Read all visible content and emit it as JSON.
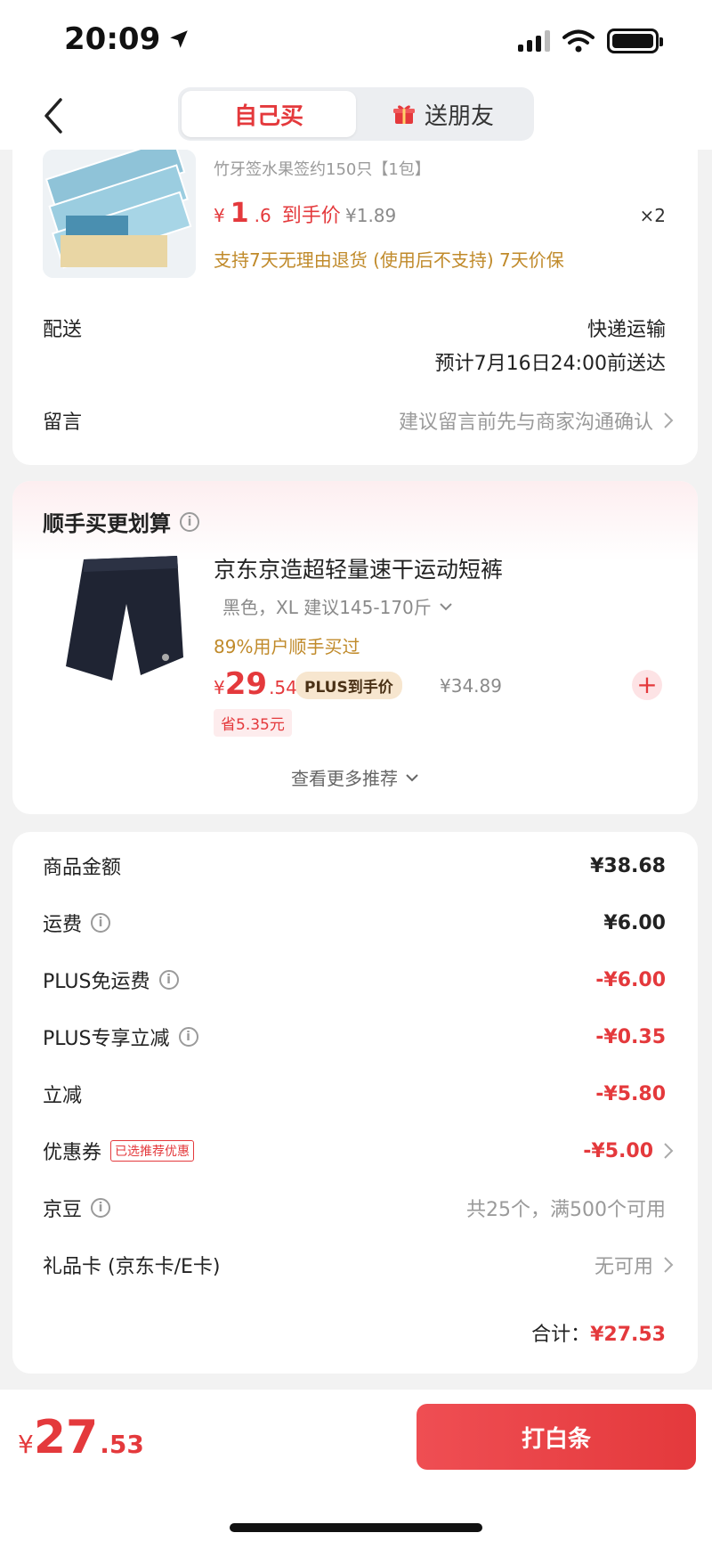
{
  "status_bar": {
    "time": "20:09"
  },
  "nav": {
    "tab_self": "自己买",
    "tab_gift": "送朋友"
  },
  "product1": {
    "subtitle": "竹牙签水果签约150只【1包】",
    "price_yen": "¥",
    "price_int": "1",
    "price_dec": ".6",
    "price_suffix": "到手价",
    "original_price": "¥1.89",
    "qty": "×2",
    "return_policy": "支持7天无理由退货 (使用后不支持)  7天价保"
  },
  "shipping": {
    "label": "配送",
    "method": "快递运输",
    "eta": "预计7月16日24:00前送达"
  },
  "message": {
    "label": "留言",
    "placeholder": "建议留言前先与商家沟通确认"
  },
  "recommend": {
    "title": "顺手买更划算",
    "product": {
      "name": "京东京造超轻量速干运动短裤",
      "spec": "黑色，XL  建议145-170斤",
      "bought_pct": "89%用户顺手买过",
      "price_yen": "¥",
      "price_int": "29",
      "price_dec": ".54",
      "plus_badge": "PLUS到手价",
      "original_price": "¥34.89",
      "save": "省5.35元"
    },
    "more": "查看更多推荐"
  },
  "summary": {
    "rows": [
      {
        "label": "商品金额",
        "value": "¥38.68"
      },
      {
        "label": "运费",
        "value": "¥6.00"
      },
      {
        "label": "PLUS免运费",
        "value": "-¥6.00"
      },
      {
        "label": "PLUS专享立减",
        "value": "-¥0.35"
      },
      {
        "label": "立减",
        "value": "-¥5.80"
      },
      {
        "label": "优惠券",
        "tag": "已选推荐优惠",
        "value": "-¥5.00"
      },
      {
        "label": "京豆",
        "value": "共25个，满500个可用"
      },
      {
        "label": "礼品卡 (京东卡/E卡)",
        "value": "无可用"
      }
    ],
    "total_label": "合计：",
    "total_value": "¥27.53"
  },
  "footer": {
    "price_yen": "¥",
    "price_int": "27",
    "price_dec": ".53",
    "pay_label": "打白条"
  },
  "colors": {
    "accent": "#e4393c",
    "gold": "#c08a2a",
    "plus_bg": "#f7e6cf"
  }
}
